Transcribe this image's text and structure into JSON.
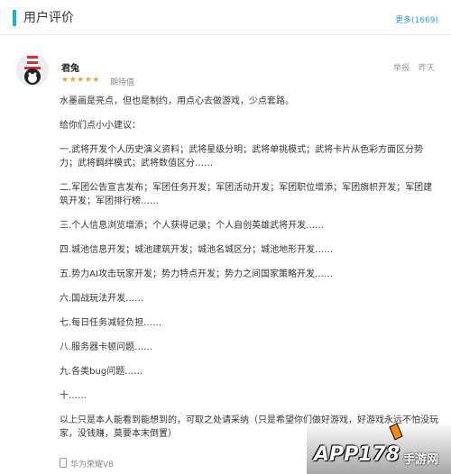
{
  "header": {
    "title": "用户评价",
    "more": "更多(1669)"
  },
  "review": {
    "user": "君兔",
    "stars": "★★★★★",
    "rating_label": "期待值",
    "report": "举报",
    "date": "昨天",
    "paragraphs": [
      "水墨画是亮点，但也是制约，用点心去做游戏，少点套路。",
      "给你们点小小建议：",
      "一.武将开发个人历史演义资料；武将星级分明；武将单挑模式；武将卡片从色彩方面区分势力；武将羁绊模式；武将数值区分……",
      "二.军团公告宣言发布；军团任务开发；军团活动开发；军团职位增添；军团旗帜开发；军团建筑开发；军团排行榜……",
      "三.个人信息浏览增添；个人获得记录；个人自创英雄武将开发……",
      "四.城池信息开发；城池建筑开发；城池名城区分；城池地形开发……",
      "五.势力AI攻击玩家开发；势力特点开发；势力之间国家策略开发……",
      "六.国战玩法开发……",
      "七.每日任务减轻负担……",
      "八.服务器卡顿问题……",
      "九.各类bug问题……",
      "十……",
      "以上只是本人能看到能想到的，可取之处请采纳（只是希望你们做好游戏，好游戏永远不怕没玩家，没钱赚，莫要本末倒置）"
    ],
    "device": "华为荣耀V8"
  },
  "watermark": {
    "text": "APP178",
    "sub": "手游网"
  },
  "colors": {
    "accent": "#19b4c4",
    "link": "#2a9fd6",
    "star": "#e8a33d"
  }
}
